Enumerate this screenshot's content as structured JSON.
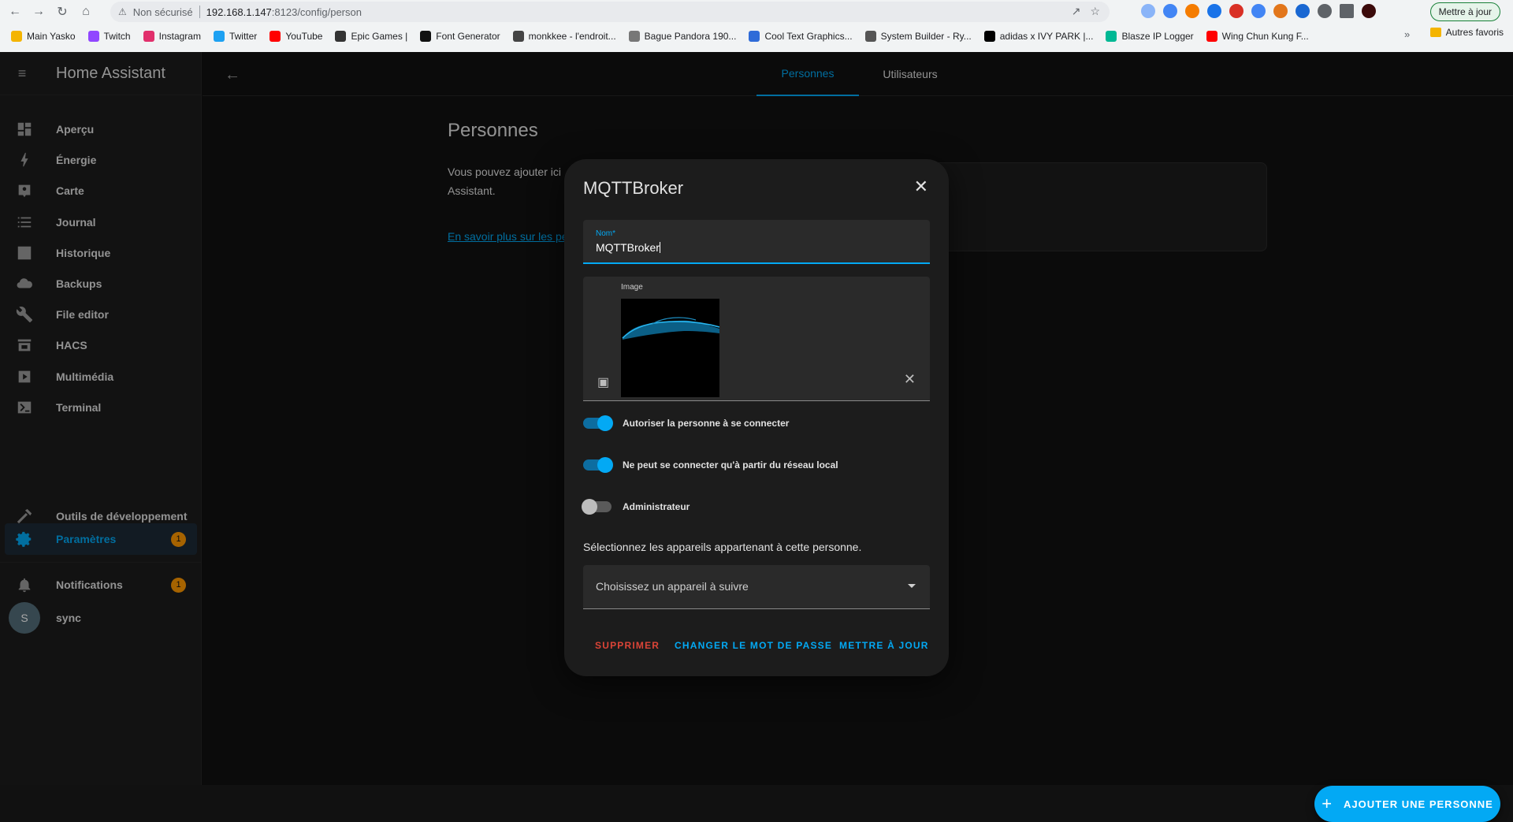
{
  "browser": {
    "insecure_label": "Non sécurisé",
    "url_host": "192.168.1.147",
    "url_path": ":8123/config/person",
    "update_button": "Mettre à jour",
    "bookmarks": [
      {
        "label": "Main Yasko",
        "color": "#f4b400"
      },
      {
        "label": "Twitch",
        "color": "#9146ff"
      },
      {
        "label": "Instagram",
        "color": "#e1306c"
      },
      {
        "label": "Twitter",
        "color": "#1da1f2"
      },
      {
        "label": "YouTube",
        "color": "#ff0000"
      },
      {
        "label": "Epic Games |",
        "color": "#333333"
      },
      {
        "label": "Font Generator",
        "color": "#111111"
      },
      {
        "label": "monkkee - l'endroit...",
        "color": "#444444"
      },
      {
        "label": "Bague Pandora 190...",
        "color": "#777777"
      },
      {
        "label": "Cool Text Graphics...",
        "color": "#2f6bd8"
      },
      {
        "label": "System Builder - Ry...",
        "color": "#555555"
      },
      {
        "label": "adidas x IVY PARK |...",
        "color": "#000000"
      },
      {
        "label": "Blasze IP Logger",
        "color": "#00b894"
      },
      {
        "label": "Wing Chun Kung F...",
        "color": "#ff0000"
      }
    ],
    "bookmarks_more": "»",
    "other_bookmarks": "Autres favoris"
  },
  "sidebar": {
    "title": "Home Assistant",
    "items": [
      {
        "label": "Aperçu",
        "icon": "dashboard-icon"
      },
      {
        "label": "Énergie",
        "icon": "lightning-icon"
      },
      {
        "label": "Carte",
        "icon": "map-icon"
      },
      {
        "label": "Journal",
        "icon": "list-icon"
      },
      {
        "label": "Historique",
        "icon": "chart-icon"
      },
      {
        "label": "Backups",
        "icon": "cloud-icon"
      },
      {
        "label": "File editor",
        "icon": "wrench-icon"
      },
      {
        "label": "HACS",
        "icon": "hacs-icon"
      },
      {
        "label": "Multimédia",
        "icon": "media-icon"
      },
      {
        "label": "Terminal",
        "icon": "terminal-icon"
      }
    ],
    "dev_tools": "Outils de développement",
    "settings": "Paramètres",
    "settings_badge": "1",
    "notifications": "Notifications",
    "notifications_badge": "1",
    "user_initial": "S",
    "user_name": "sync"
  },
  "topbar": {
    "tabs": [
      "Personnes",
      "Utilisateurs"
    ]
  },
  "page": {
    "title": "Personnes",
    "intro": "Vous pouvez ajouter ici\nAssistant.",
    "learn_more": "En savoir plus sur les pe"
  },
  "dialog": {
    "title": "MQTTBroker",
    "name_label": "Nom*",
    "name_value": "MQTTBroker",
    "image_label": "Image",
    "toggle_login": "Autoriser la personne à se connecter",
    "toggle_login_on": true,
    "toggle_local": "Ne peut se connecter qu'à partir du réseau local",
    "toggle_local_on": true,
    "toggle_admin": "Administrateur",
    "toggle_admin_on": false,
    "devices_text": "Sélectionnez les appareils appartenant à cette personne.",
    "device_placeholder": "Choisissez un appareil à suivre",
    "btn_delete": "SUPPRIMER",
    "btn_password": "CHANGER LE MOT DE PASSE",
    "btn_update": "METTRE À JOUR"
  },
  "fab": {
    "label": "AJOUTER UNE PERSONNE"
  },
  "colors": {
    "accent": "#03a9f4",
    "danger": "#db4437",
    "badge": "#ff9800"
  }
}
